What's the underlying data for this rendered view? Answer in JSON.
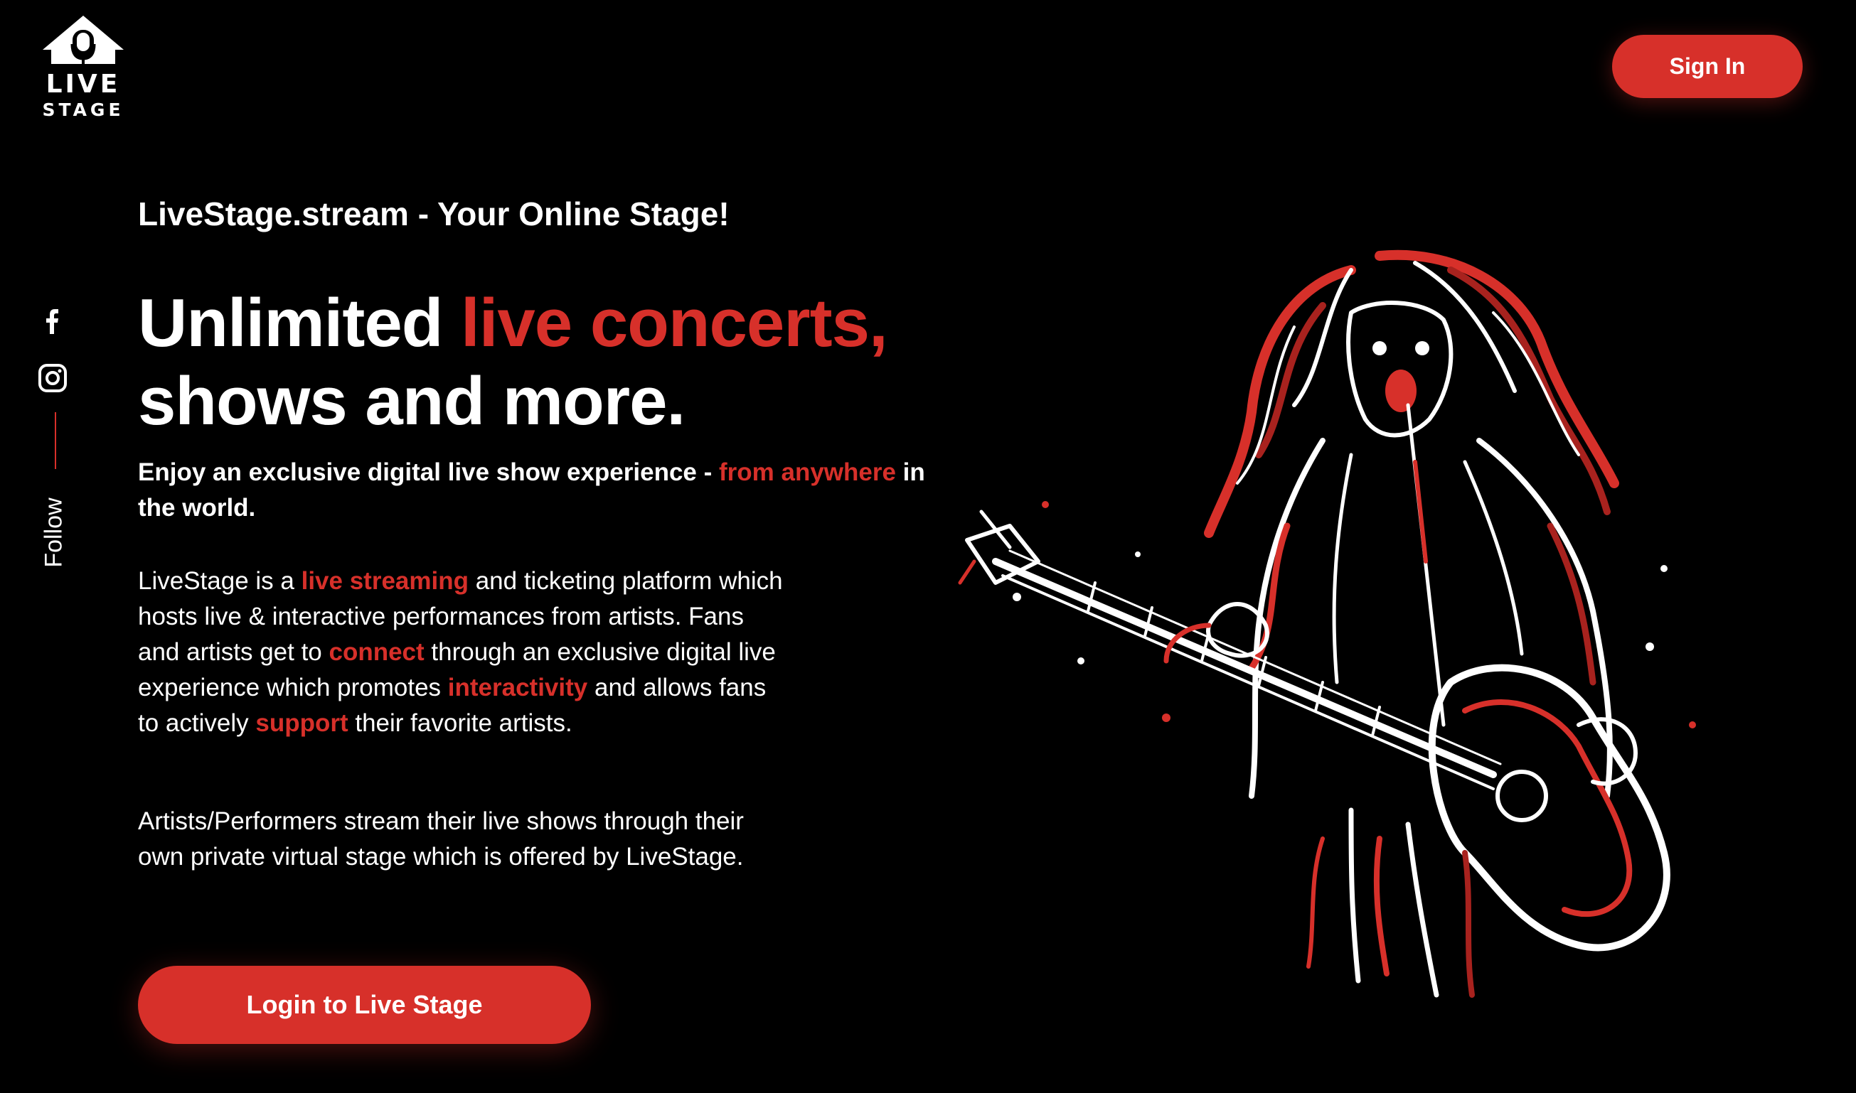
{
  "brand": {
    "logo_line1": "LIVE",
    "logo_line2": "STAGE",
    "accent_color": "#d7302a",
    "background_color": "#000000"
  },
  "header": {
    "sign_in_label": "Sign In"
  },
  "social": {
    "icons": [
      "facebook-icon",
      "instagram-icon"
    ],
    "follow_label": "Follow"
  },
  "hero": {
    "tagline": "LiveStage.stream - Your Online Stage!",
    "headline_part1": "Unlimited ",
    "headline_highlight": "live concerts,",
    "headline_part2": "shows and more.",
    "subhead_part1": "Enjoy an exclusive digital live show experience - ",
    "subhead_highlight": "from anywhere",
    "subhead_part2": " in the world.",
    "para1": {
      "t1": "LiveStage is a ",
      "h1": "live streaming",
      "t2": " and ticketing platform which hosts live & interactive performances from artists. Fans and artists get to ",
      "h2": "connect",
      "t3": " through an exclusive digital live experience which promotes ",
      "h3": "interactivity",
      "t4": " and allows fans to actively ",
      "h4": "support",
      "t5": " their favorite artists."
    },
    "para2": "Artists/Performers stream their live shows through their own private virtual stage which is offered by LiveStage.",
    "cta_label": "Login to Live Stage"
  },
  "illustration": {
    "icon": "guitarist-illustration"
  }
}
